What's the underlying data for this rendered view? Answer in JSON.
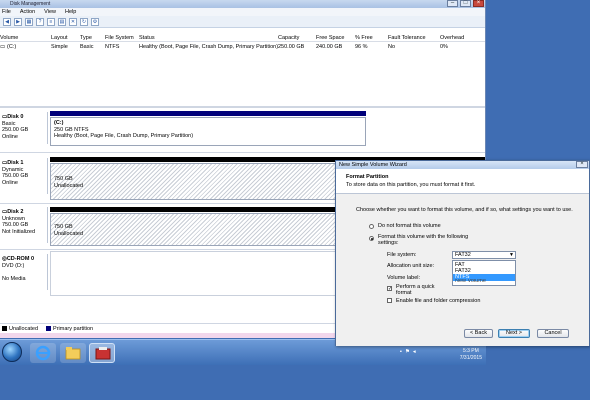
{
  "window": {
    "title": "Disk Management"
  },
  "menu": [
    "File",
    "Action",
    "View",
    "Help"
  ],
  "volume_table": {
    "headers": [
      "Volume",
      "Layout",
      "Type",
      "File System",
      "Status",
      "Capacity",
      "Free Space",
      "% Free",
      "Fault Tolerance",
      "Overhead"
    ],
    "rows": [
      [
        "(C:)",
        "Simple",
        "Basic",
        "NTFS",
        "Healthy (Boot, Page File, Crash Dump, Primary Partition)",
        "250.00 GB",
        "240.00 GB",
        "96 %",
        "No",
        "0%"
      ]
    ]
  },
  "disks": [
    {
      "name": "Disk 0",
      "type": "Basic",
      "size": "250.00 GB",
      "status": "Online",
      "vol_name": "(C:)",
      "vol_size": "250 GB NTFS",
      "vol_status": "Healthy (Boot, Page File, Crash Dump, Primary Partition)"
    },
    {
      "name": "Disk 1",
      "type": "Dynamic",
      "size": "750.00 GB",
      "status": "Online",
      "vol_size": "750 GB",
      "vol_status": "Unallocated"
    },
    {
      "name": "Disk 2",
      "type": "Unknown",
      "size": "750.00 GB",
      "status": "Not Initialized",
      "vol_size": "750 GB",
      "vol_status": "Unallocated"
    },
    {
      "name": "CD-ROM 0",
      "type": "DVD (D:)",
      "status": "No Media"
    }
  ],
  "legend": {
    "unallocated": "Unallocated",
    "primary": "Primary partition"
  },
  "colors": {
    "primary": "#00007a",
    "unallocated": "#000000",
    "taskbar": "#3d6fb6",
    "desktop": "#3f6db3"
  },
  "taskbar": {
    "icons": [
      "start-orb",
      "internet-explorer",
      "windows-explorer",
      "computer-management"
    ],
    "time": "5:3 PM",
    "date": "7/31/2015"
  },
  "wizard": {
    "title": "New Simple Volume Wizard",
    "header_title": "Format Partition",
    "header_desc": "To store data on this partition, you must format it first.",
    "question": "Choose whether you want to format this volume, and if so, what settings you want to use.",
    "opt_no_format": "Do not format this volume",
    "opt_format": "Format this volume with the following settings:",
    "fs_label": "File system:",
    "fs_value": "FAT32",
    "alloc_label": "Allocation unit size:",
    "vol_label": "Volume label:",
    "quick_format": "Perform a quick format",
    "compression": "Enable file and folder compression",
    "dropdown_options": [
      "FAT",
      "FAT32",
      "NTFS",
      "New Volume"
    ],
    "back": "< Back",
    "next": "Next >",
    "cancel": "Cancel"
  }
}
